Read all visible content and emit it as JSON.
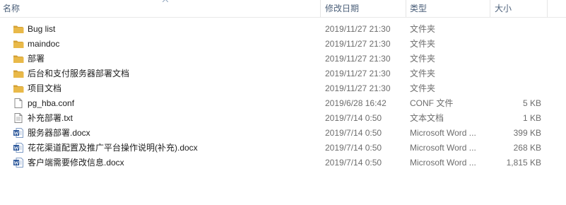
{
  "columns": {
    "name": "名称",
    "date": "修改日期",
    "type": "类型",
    "size": "大小"
  },
  "colors": {
    "folder": "#e9b949",
    "folder_dark": "#d4a135",
    "word_blue": "#2b579a",
    "header_text": "#4c607a"
  },
  "files": [
    {
      "icon": "folder-icon",
      "name": "Bug list",
      "date": "2019/11/27 21:30",
      "type": "文件夹",
      "size": ""
    },
    {
      "icon": "folder-icon",
      "name": "maindoc",
      "date": "2019/11/27 21:30",
      "type": "文件夹",
      "size": ""
    },
    {
      "icon": "folder-icon",
      "name": "部署",
      "date": "2019/11/27 21:30",
      "type": "文件夹",
      "size": ""
    },
    {
      "icon": "folder-icon",
      "name": "后台和支付服务器部署文档",
      "date": "2019/11/27 21:30",
      "type": "文件夹",
      "size": ""
    },
    {
      "icon": "folder-icon",
      "name": "项目文档",
      "date": "2019/11/27 21:30",
      "type": "文件夹",
      "size": ""
    },
    {
      "icon": "file-icon",
      "name": "pg_hba.conf",
      "date": "2019/6/28 16:42",
      "type": "CONF 文件",
      "size": "5 KB"
    },
    {
      "icon": "text-file-icon",
      "name": "补充部署.txt",
      "date": "2019/7/14 0:50",
      "type": "文本文档",
      "size": "1 KB"
    },
    {
      "icon": "word-doc-icon",
      "name": "服务器部署.docx",
      "date": "2019/7/14 0:50",
      "type": "Microsoft Word ...",
      "size": "399 KB"
    },
    {
      "icon": "word-doc-icon",
      "name": "花花渠道配置及推广平台操作说明(补充).docx",
      "date": "2019/7/14 0:50",
      "type": "Microsoft Word ...",
      "size": "268 KB"
    },
    {
      "icon": "word-doc-icon",
      "name": "客户端需要修改信息.docx",
      "date": "2019/7/14 0:50",
      "type": "Microsoft Word ...",
      "size": "1,815 KB"
    }
  ]
}
